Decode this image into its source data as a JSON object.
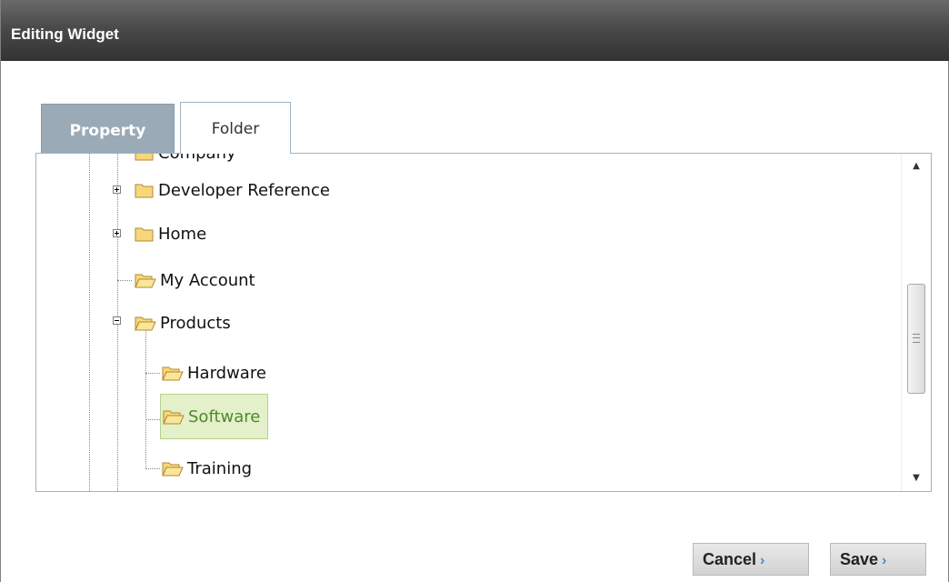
{
  "window": {
    "title": "Editing Widget"
  },
  "tabs": [
    {
      "label": "Property",
      "active": false
    },
    {
      "label": "Folder",
      "active": true
    }
  ],
  "tree": {
    "nodes": [
      {
        "label": "Company",
        "state": "closed"
      },
      {
        "label": "Developer Reference",
        "state": "closed",
        "toggle": "+"
      },
      {
        "label": "Home",
        "state": "closed",
        "toggle": "+"
      },
      {
        "label": "My Account",
        "state": "open"
      },
      {
        "label": "Products",
        "state": "open",
        "toggle": "−"
      },
      {
        "label": "Hardware",
        "state": "open"
      },
      {
        "label": "Software",
        "state": "open",
        "selected": true
      },
      {
        "label": "Training",
        "state": "open"
      }
    ]
  },
  "buttons": {
    "cancel": "Cancel",
    "save": "Save",
    "arrow": "›"
  },
  "scrollbar": {
    "up": "▲",
    "down": "▼"
  },
  "colors": {
    "titlebar": "#3f3f3f",
    "selected_bg": "#e3f0c9",
    "selected_text": "#4c8a2c",
    "accent_arrow": "#3c8fd1"
  }
}
